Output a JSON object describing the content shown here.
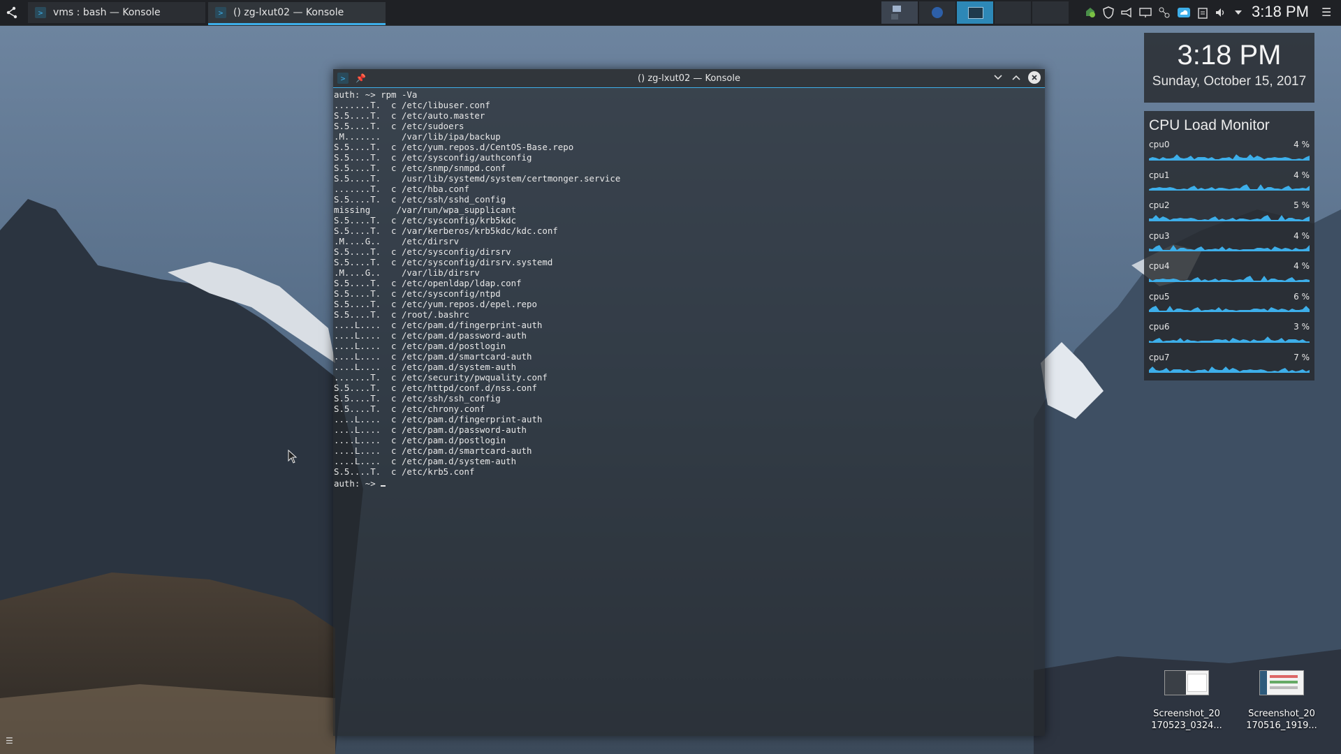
{
  "taskbar": {
    "tasks": [
      {
        "label": "vms : bash — Konsole",
        "active": false
      },
      {
        "label": "() zg-lxut02 — Konsole",
        "active": true
      }
    ],
    "clock": "3:18 PM"
  },
  "window": {
    "title": "() zg-lxut02 — Konsole",
    "lines": [
      "auth: ~> rpm -Va",
      ".......T.  c /etc/libuser.conf",
      "S.5....T.  c /etc/auto.master",
      "S.5....T.  c /etc/sudoers",
      ".M.......    /var/lib/ipa/backup",
      "S.5....T.  c /etc/yum.repos.d/CentOS-Base.repo",
      "S.5....T.  c /etc/sysconfig/authconfig",
      "S.5....T.  c /etc/snmp/snmpd.conf",
      "S.5....T.    /usr/lib/systemd/system/certmonger.service",
      ".......T.  c /etc/hba.conf",
      "S.5....T.  c /etc/ssh/sshd_config",
      "missing     /var/run/wpa_supplicant",
      "S.5....T.  c /etc/sysconfig/krb5kdc",
      "S.5....T.  c /var/kerberos/krb5kdc/kdc.conf",
      ".M....G..    /etc/dirsrv",
      "S.5....T.  c /etc/sysconfig/dirsrv",
      "S.5....T.  c /etc/sysconfig/dirsrv.systemd",
      ".M....G..    /var/lib/dirsrv",
      "S.5....T.  c /etc/openldap/ldap.conf",
      "S.5....T.  c /etc/sysconfig/ntpd",
      "S.5....T.  c /etc/yum.repos.d/epel.repo",
      "S.5....T.  c /root/.bashrc",
      "....L....  c /etc/pam.d/fingerprint-auth",
      "....L....  c /etc/pam.d/password-auth",
      "....L....  c /etc/pam.d/postlogin",
      "....L....  c /etc/pam.d/smartcard-auth",
      "....L....  c /etc/pam.d/system-auth",
      ".......T.  c /etc/security/pwquality.conf",
      "S.5....T.  c /etc/httpd/conf.d/nss.conf",
      "S.5....T.  c /etc/ssh/ssh_config",
      "S.5....T.  c /etc/chrony.conf",
      "....L....  c /etc/pam.d/fingerprint-auth",
      "....L....  c /etc/pam.d/password-auth",
      "....L....  c /etc/pam.d/postlogin",
      "....L....  c /etc/pam.d/smartcard-auth",
      "....L....  c /etc/pam.d/system-auth",
      "S.5....T.  c /etc/krb5.conf"
    ],
    "prompt": "auth: ~> "
  },
  "clock_widget": {
    "time": "3:18 PM",
    "date": "Sunday, October 15, 2017"
  },
  "cpu_widget": {
    "title": "CPU Load Monitor",
    "cpus": [
      {
        "name": "cpu0",
        "value": "4 %"
      },
      {
        "name": "cpu1",
        "value": "4 %"
      },
      {
        "name": "cpu2",
        "value": "5 %"
      },
      {
        "name": "cpu3",
        "value": "4 %"
      },
      {
        "name": "cpu4",
        "value": "4 %"
      },
      {
        "name": "cpu5",
        "value": "6 %"
      },
      {
        "name": "cpu6",
        "value": "3 %"
      },
      {
        "name": "cpu7",
        "value": "7 %"
      }
    ],
    "graph_color": "#3daee9"
  },
  "desktop_icons": [
    {
      "line1": "Screenshot_20",
      "line2": "170523_0324..."
    },
    {
      "line1": "Screenshot_20",
      "line2": "170516_1919..."
    }
  ],
  "colors": {
    "accent": "#3daee9",
    "panel": "#1f2125"
  }
}
